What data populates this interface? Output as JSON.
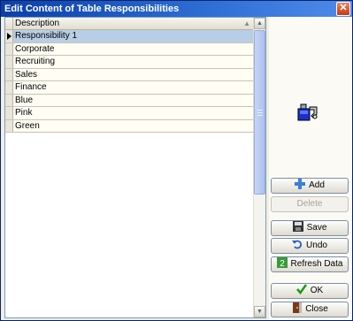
{
  "window": {
    "title": "Edit Content of Table Responsibilities",
    "close_label": "✕"
  },
  "grid": {
    "column_header": "Description",
    "rows": [
      {
        "label": "Responsibility 1"
      },
      {
        "label": "Corporate"
      },
      {
        "label": "Recruiting"
      },
      {
        "label": "Sales"
      },
      {
        "label": "Finance"
      },
      {
        "label": "Blue"
      },
      {
        "label": "Pink"
      },
      {
        "label": "Green"
      }
    ],
    "selected_row": "Responsibility 1"
  },
  "buttons": {
    "add": "Add",
    "delete": "Delete",
    "save": "Save",
    "undo": "Undo",
    "refresh": "Refresh Data",
    "ok": "OK",
    "close": "Close"
  },
  "icons": {
    "logo": "table-edit-icon",
    "add": "plus-icon",
    "save": "floppy-icon",
    "undo": "undo-icon",
    "refresh": "refresh-icon",
    "ok": "checkmark-icon",
    "close": "door-exit-icon"
  },
  "colors": {
    "title_bar": "#0a3fa8",
    "selection": "#b8cde6",
    "scroll_thumb": "#aac0ee"
  }
}
